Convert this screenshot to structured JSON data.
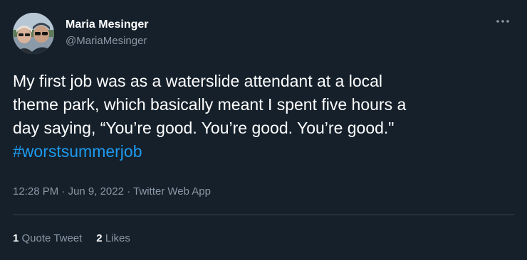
{
  "author": {
    "display_name": "Maria Mesinger",
    "handle": "@MariaMesinger"
  },
  "tweet": {
    "line1": "My first job was as a waterslide attendant at a local",
    "line2": "theme park, which basically meant I spent five hours a",
    "line3": "day saying, “You’re good. You’re good. You’re good.\"",
    "hashtag": "#worstsummerjob"
  },
  "meta": {
    "time": "12:28 PM",
    "sep1": " · ",
    "date": "Jun 9, 2022",
    "sep2": " · ",
    "source": "Twitter Web App"
  },
  "stats": {
    "quote_count": "1",
    "quote_label": "Quote Tweet",
    "like_count": "2",
    "like_label": "Likes"
  },
  "icons": {
    "more": "more-dots-icon"
  },
  "colors": {
    "background": "#15202b",
    "text": "#ffffff",
    "muted": "#8b98a5",
    "accent": "#1d9bf0",
    "divider": "#38444d"
  }
}
